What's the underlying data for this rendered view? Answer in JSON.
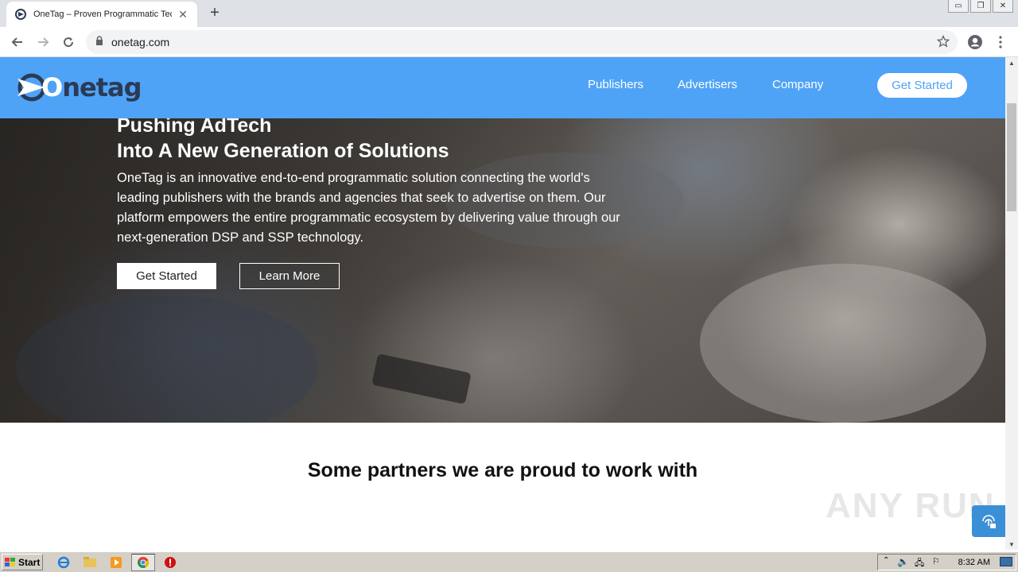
{
  "browser": {
    "tab_title": "OneTag – Proven Programmatic Tech",
    "tab_close": "✕",
    "new_tab": "+",
    "url": "onetag.com",
    "window_controls": [
      "▭",
      "❐",
      "✕"
    ]
  },
  "site": {
    "logo_text_prefix": "O",
    "logo_text_rest": "netag",
    "nav": [
      "Publishers",
      "Advertisers",
      "Company"
    ],
    "header_cta": "Get Started"
  },
  "hero": {
    "title_line1": "Pushing AdTech",
    "title_line2": "Into A New Generation of Solutions",
    "description": "OneTag is an innovative end-to-end programmatic solution connecting the world's leading publishers with the brands and agencies that seek to advertise on them. Our platform empowers the entire programmatic ecosystem by delivering value through our next-generation DSP and SSP technology.",
    "primary_button": "Get Started",
    "secondary_button": "Learn More"
  },
  "partners": {
    "title": "Some partners we are proud to work with"
  },
  "watermark": "ANY RUN",
  "taskbar": {
    "start_label": "Start",
    "clock": "8:32 AM"
  },
  "colors": {
    "header_blue": "#4fa3f7",
    "logo_navy": "#2b3a55"
  }
}
